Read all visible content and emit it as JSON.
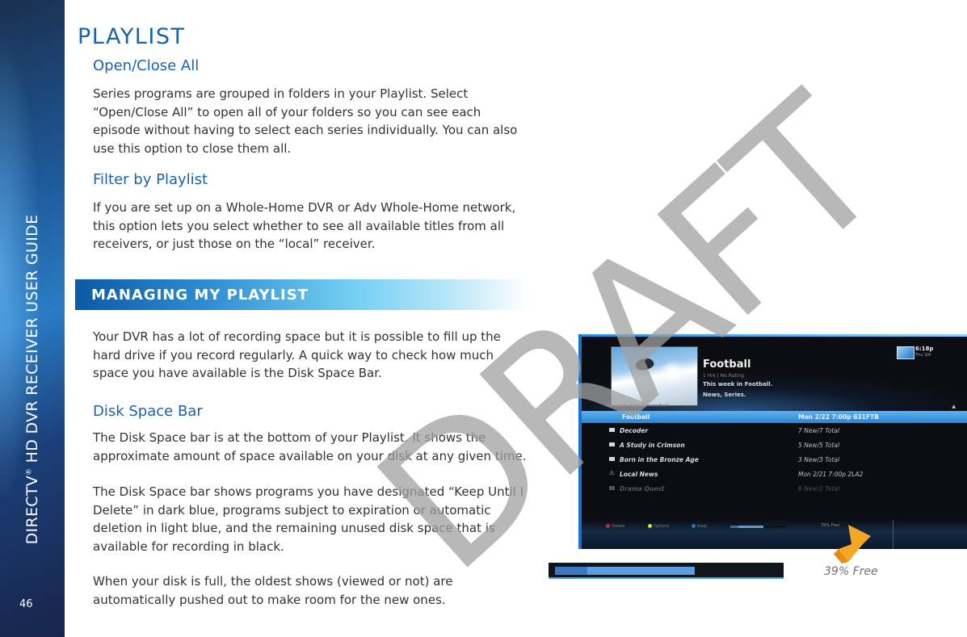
{
  "sidebar": {
    "guide_title_prefix": "DIRECTV",
    "registered_mark": "®",
    "guide_title_suffix": " HD DVR RECEIVER USER GUIDE",
    "page_number": "46"
  },
  "heading": "PLAYLIST",
  "sections": {
    "open_close": {
      "title": "Open/Close All",
      "body": "Series programs are grouped in folders in your Playlist. Select “Open/Close All” to open all of your folders so you can see each episode without having to select each series individually. You can also use this option to close them all."
    },
    "filter": {
      "title": "Filter by Playlist",
      "body": "If you are set up on a Whole-Home DVR or Adv Whole-Home network, this option lets you select whether to see all available titles from all receivers, or just those on the “local” receiver."
    },
    "managing": {
      "banner": "MANAGING MY PLAYLIST",
      "body": "Your DVR has a lot of recording space but it is possible to fill up the hard drive if you record regularly.  A quick way to check how much space you have available is the Disk Space Bar."
    },
    "disk_space": {
      "title": "Disk Space Bar",
      "body1": "The Disk Space bar is at the bottom of your Playlist.  It shows the approximate amount of space available on your disk at any given time.",
      "body2": "The Disk Space bar shows programs you have designated “Keep Until I Delete” in dark blue, programs subject to expiration or automatic deletion in light blue, and the remaining unused disk space that is available for recording in black.",
      "body3": "When your disk is full, the oldest shows (viewed or not) are automatically pushed out to make room for the new ones."
    }
  },
  "watermark": "DRAFT",
  "tv": {
    "program_title": "Football",
    "program_meta": "1 Hrs  |  No Rating",
    "program_desc": "This week in Football.",
    "program_genre": "News, Series.",
    "clock": "6:18p",
    "date": "Thu 3/4",
    "order_label": "Ordered By Date (Newest First)",
    "rows": [
      {
        "name": "Football",
        "info": "Mon 2/22    7:00p    631FTB",
        "type": "selected"
      },
      {
        "name": "Decoder",
        "info": "7 New/7 Total",
        "type": "folder"
      },
      {
        "name": "A Study in Crimson",
        "info": "5 New/5 Total",
        "type": "folder"
      },
      {
        "name": "Born in the Bronze Age",
        "info": "3 New/3 Total",
        "type": "folder"
      },
      {
        "name": "Local News",
        "info": "Mon 2/21    7:00p    2LA2",
        "type": "warning"
      },
      {
        "name": "Drama Quest",
        "info": "6 New/2 Total",
        "type": "folder-dim"
      }
    ],
    "legend": [
      {
        "label": "Delete",
        "color": "#d2272e"
      },
      {
        "label": "Options",
        "color": "#d6e03a"
      },
      {
        "label": "Keep",
        "color": "#2f6fd0"
      }
    ],
    "free_mini": "39% Free",
    "disk": {
      "keep_percent": 14,
      "expire_percent": 47,
      "free_percent": 39
    }
  },
  "disk_bar": {
    "keep_percent": 14,
    "expire_percent": 47,
    "free_percent": 39,
    "free_label": "39% Free",
    "colors": {
      "keep": "#3a78c0",
      "expire": "#5b9ee0",
      "free": "#12141c"
    }
  },
  "colors": {
    "heading_blue": "#1a63a8",
    "body_text": "#333333",
    "callout_orange": "#f5a623"
  }
}
